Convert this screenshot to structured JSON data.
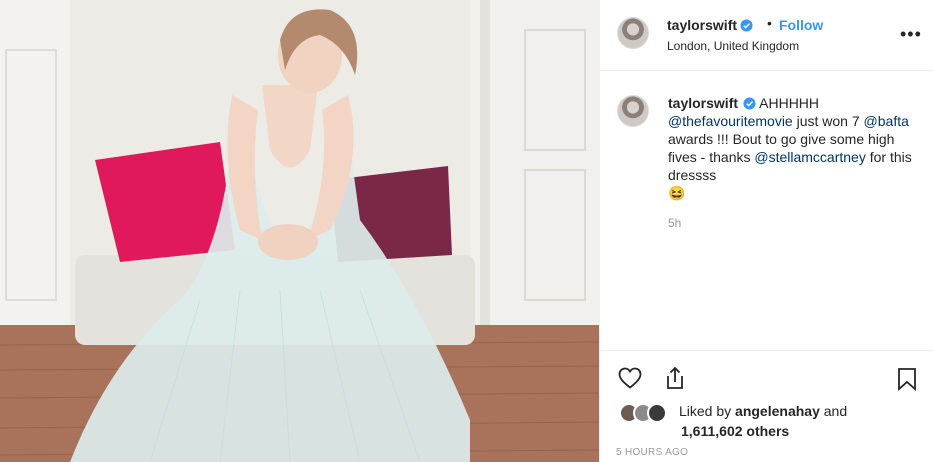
{
  "post": {
    "username": "taylorswift",
    "separator": "•",
    "follow_label": "Follow",
    "location": "London, United Kingdom",
    "more_label": "•••"
  },
  "comment": {
    "username": "taylorswift",
    "text_1": " AHHHHH ",
    "mention_1": "@thefavouritemovie",
    "text_2": " just won 7 ",
    "mention_2": "@bafta",
    "text_3": " awards !!! Bout to go give some high fives - thanks ",
    "mention_3": "@stellamccartney",
    "text_4": " for this dressss",
    "emoji": "😆",
    "time": "5h"
  },
  "likes": {
    "prefix": "Liked by ",
    "user": "angelenahay",
    "connector": " and",
    "count": "1,611,602 others"
  },
  "timestamp": "5 HOURS AGO",
  "icons": [
    "verified-badge-icon",
    "heart-icon",
    "share-icon",
    "bookmark-icon"
  ],
  "colors": {
    "accent": "#3897f0",
    "mention": "#003569",
    "muted": "#999999"
  }
}
